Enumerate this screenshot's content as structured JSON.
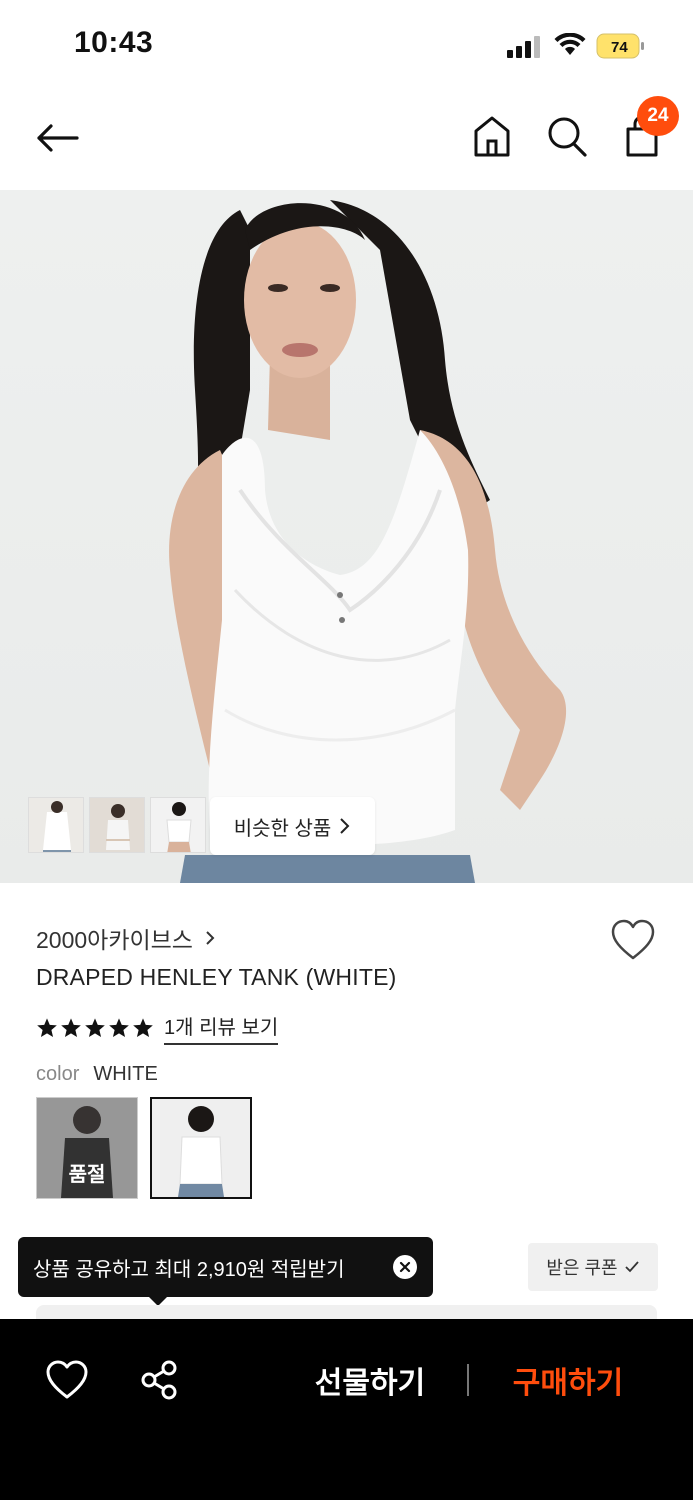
{
  "status_bar": {
    "time": "10:43",
    "battery_level": "74",
    "icons": [
      "signal-icon",
      "wifi-icon",
      "battery-icon"
    ]
  },
  "nav": {
    "cart_count": "24",
    "icons": [
      "back-arrow-icon",
      "home-icon",
      "search-icon",
      "cart-icon"
    ]
  },
  "hero": {
    "similar_label": "비슷한 상품"
  },
  "product": {
    "brand": "2000아카이브스",
    "name": "DRAPED HENLEY TANK (WHITE)",
    "rating": 5,
    "rating_max": 5,
    "review_link": "1개 리뷰 보기",
    "color_label": "color",
    "color_value": "WHITE",
    "swatches": [
      {
        "overlay": "품절",
        "selected": false
      },
      {
        "overlay": "",
        "selected": true
      }
    ]
  },
  "tooltip": {
    "text": "상품 공유하고 최대 2,910원 적립받기"
  },
  "coupon": {
    "label": "받은 쿠폰"
  },
  "bottom_bar": {
    "gift_label": "선물하기",
    "buy_label": "구매하기"
  },
  "colors": {
    "accent": "#ff4d0d",
    "bottom_bar_bg": "#000000"
  }
}
